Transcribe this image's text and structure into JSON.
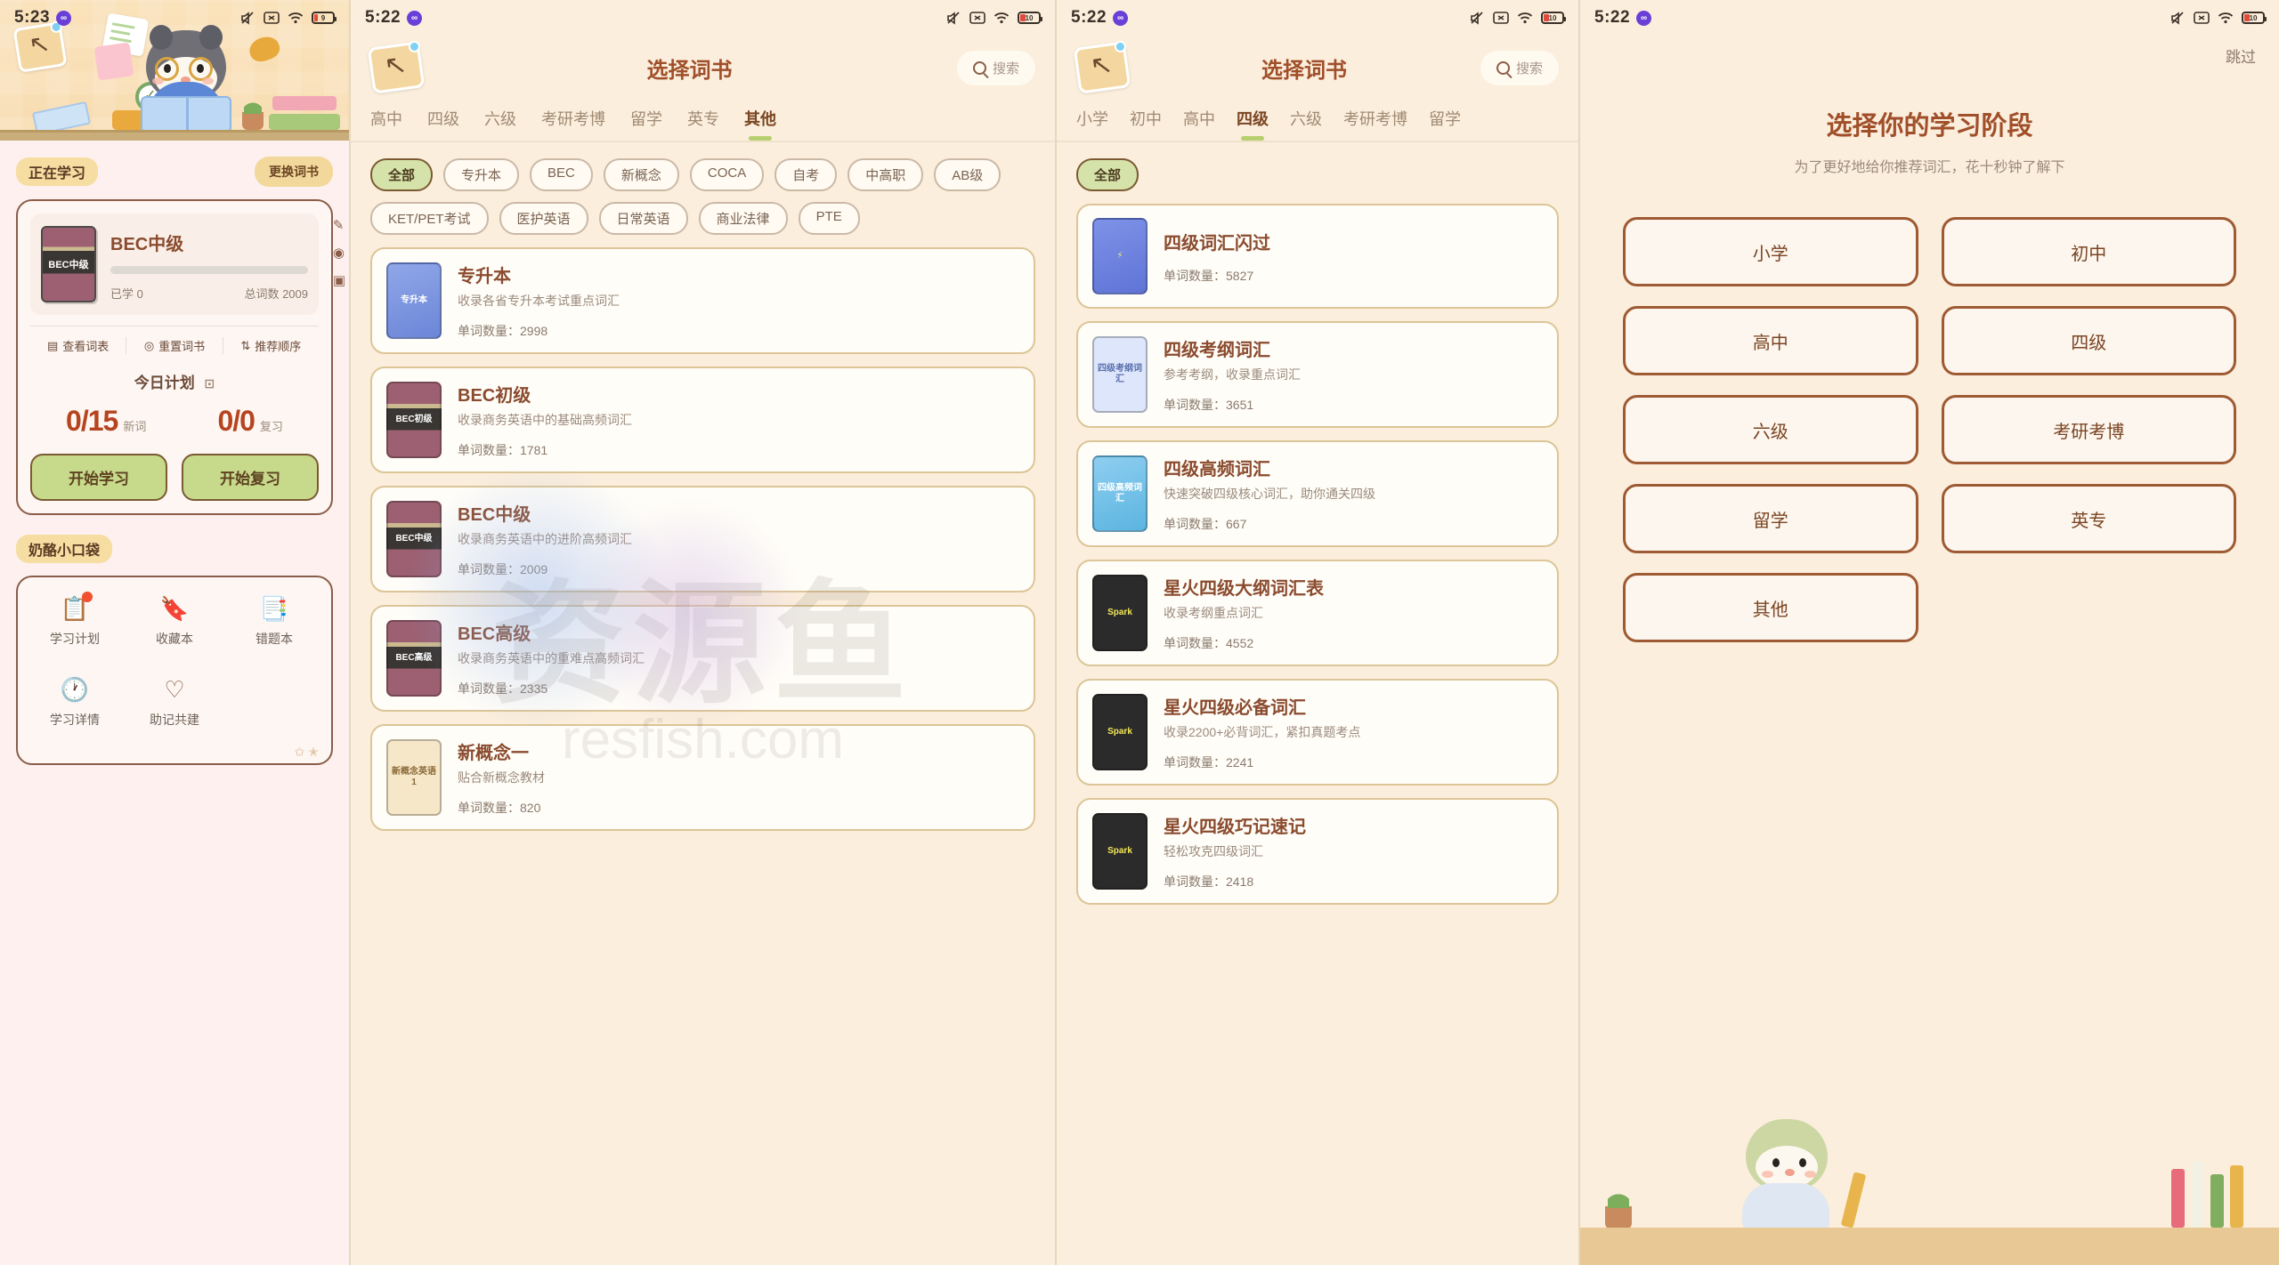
{
  "panel1": {
    "status": {
      "time": "5:23",
      "dot_icon": "app-dot-icon",
      "battery": "9",
      "icons": [
        "mute-icon",
        "nfc-icon",
        "wifi-icon",
        "battery-icon"
      ]
    },
    "section_studying": "正在学习",
    "change_book_button": "更换词书",
    "book": {
      "cover_label": "BEC中级",
      "title": "BEC中级",
      "learned_label": "已学 0",
      "total_label": "总词数 2009",
      "progress_percent": 0
    },
    "book_actions": [
      {
        "icon": "list-icon",
        "label": "查看词表"
      },
      {
        "icon": "reset-icon",
        "label": "重置词书"
      },
      {
        "icon": "sort-icon",
        "label": "推荐顺序"
      }
    ],
    "side_icons": [
      "edit-icon",
      "headphone-icon",
      "book-icon"
    ],
    "plan": {
      "title": "今日计划",
      "edit_icon": "edit-square-icon",
      "new_words": {
        "value": "0/15",
        "label": "新词"
      },
      "review": {
        "value": "0/0",
        "label": "复习"
      },
      "start_study_button": "开始学习",
      "start_review_button": "开始复习"
    },
    "section_pocket": "奶酪小口袋",
    "tools": [
      {
        "icon": "clipboard-check-icon",
        "label": "学习计划",
        "badge": true
      },
      {
        "icon": "bookmark-icon",
        "label": "收藏本",
        "badge": false
      },
      {
        "icon": "error-book-icon",
        "label": "错题本",
        "badge": false
      },
      {
        "icon": "clock-icon",
        "label": "学习详情",
        "badge": false
      },
      {
        "icon": "heart-icon",
        "label": "助记共建",
        "badge": false
      }
    ],
    "stars": "✩ ✭"
  },
  "panel2": {
    "status": {
      "time": "5:22",
      "battery": "10"
    },
    "back_icon": "back-note-icon",
    "title": "选择词书",
    "search": {
      "icon": "search-icon",
      "label": "搜索"
    },
    "tabs": [
      {
        "label": "高中",
        "active": false
      },
      {
        "label": "四级",
        "active": false
      },
      {
        "label": "六级",
        "active": false
      },
      {
        "label": "考研考博",
        "active": false
      },
      {
        "label": "留学",
        "active": false
      },
      {
        "label": "英专",
        "active": false
      },
      {
        "label": "其他",
        "active": true
      }
    ],
    "chips": [
      {
        "label": "全部",
        "active": true
      },
      {
        "label": "专升本",
        "active": false
      },
      {
        "label": "BEC",
        "active": false
      },
      {
        "label": "新概念",
        "active": false
      },
      {
        "label": "COCA",
        "active": false
      },
      {
        "label": "自考",
        "active": false
      },
      {
        "label": "中高职",
        "active": false
      },
      {
        "label": "AB级",
        "active": false
      },
      {
        "label": "KET/PET考试",
        "active": false
      },
      {
        "label": "医护英语",
        "active": false
      },
      {
        "label": "日常英语",
        "active": false
      },
      {
        "label": "商业法律",
        "active": false
      },
      {
        "label": "PTE",
        "active": false
      }
    ],
    "books": [
      {
        "cover_label": "专升本",
        "title": "专升本",
        "desc": "收录各省专升本考试重点词汇",
        "count": "单词数量：2998",
        "cover_style": "blue"
      },
      {
        "cover_label": "BEC初级",
        "title": "BEC初级",
        "desc": "收录商务英语中的基础高频词汇",
        "count": "单词数量：1781",
        "cover_style": "maroon"
      },
      {
        "cover_label": "BEC中级",
        "title": "BEC中级",
        "desc": "收录商务英语中的进阶高频词汇",
        "count": "单词数量：2009",
        "cover_style": "maroon"
      },
      {
        "cover_label": "BEC高级",
        "title": "BEC高级",
        "desc": "收录商务英语中的重难点高频词汇",
        "count": "单词数量：2335",
        "cover_style": "maroon"
      },
      {
        "cover_label": "新概念英语1",
        "title": "新概念一",
        "desc": "贴合新概念教材",
        "count": "单词数量：820",
        "cover_style": "cream"
      }
    ],
    "watermark_main": "资源鱼",
    "watermark_sub": "resfish.com"
  },
  "panel3": {
    "status": {
      "time": "5:22",
      "battery": "10"
    },
    "back_icon": "back-note-icon",
    "title": "选择词书",
    "search": {
      "icon": "search-icon",
      "label": "搜索"
    },
    "tabs": [
      {
        "label": "小学",
        "active": false
      },
      {
        "label": "初中",
        "active": false
      },
      {
        "label": "高中",
        "active": false
      },
      {
        "label": "四级",
        "active": true
      },
      {
        "label": "六级",
        "active": false
      },
      {
        "label": "考研考博",
        "active": false
      },
      {
        "label": "留学",
        "active": false
      }
    ],
    "chips": [
      {
        "label": "全部",
        "active": true
      }
    ],
    "books": [
      {
        "cover_label": "四级词汇闪过",
        "title": "四级词汇闪过",
        "desc": "",
        "count": "单词数量：5827",
        "cover_style": "flash"
      },
      {
        "cover_label": "四级考纲词汇",
        "title": "四级考纲词汇",
        "desc": "参考考纲，收录重点词汇",
        "count": "单词数量：3651",
        "cover_style": "lightblue"
      },
      {
        "cover_label": "四级高频词汇",
        "title": "四级高频词汇",
        "desc": "快速突破四级核心词汇，助你通关四级",
        "count": "单词数量：667",
        "cover_style": "sky"
      },
      {
        "cover_label": "Spark",
        "title": "星火四级大纲词汇表",
        "desc": "收录考纲重点词汇",
        "count": "单词数量：4552",
        "cover_style": "spark"
      },
      {
        "cover_label": "Spark",
        "title": "星火四级必备词汇",
        "desc": "收录2200+必背词汇，紧扣真题考点",
        "count": "单词数量：2241",
        "cover_style": "spark"
      },
      {
        "cover_label": "Spark",
        "title": "星火四级巧记速记",
        "desc": "轻松攻克四级词汇",
        "count": "单词数量：2418",
        "cover_style": "spark"
      }
    ]
  },
  "panel4": {
    "status": {
      "time": "5:22",
      "battery": "10"
    },
    "skip_label": "跳过",
    "title": "选择你的学习阶段",
    "subtitle": "为了更好地给你推荐词汇，花十秒钟了解下",
    "stages": [
      "小学",
      "初中",
      "高中",
      "四级",
      "六级",
      "考研考博",
      "留学",
      "英专",
      "其他"
    ]
  },
  "colors": {
    "page_bg": "#fbeedc",
    "panel1_bg": "#fdf0ee",
    "accent_brown": "#a04f2a",
    "accent_green": "#c7d98a",
    "tab_underline": "#b7cf6e",
    "card_border": "#dcc597",
    "badge_red": "#f2502f"
  }
}
